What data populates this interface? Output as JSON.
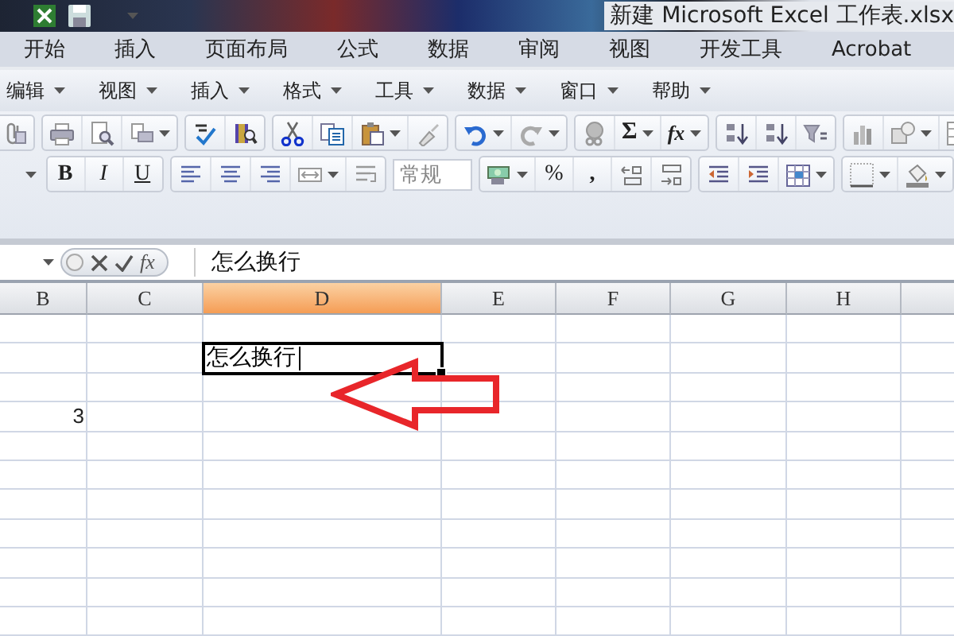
{
  "window": {
    "title": "新建 Microsoft Excel 工作表.xlsx"
  },
  "ribbon_tabs": [
    {
      "label": "开始"
    },
    {
      "label": "插入"
    },
    {
      "label": "页面布局"
    },
    {
      "label": "公式"
    },
    {
      "label": "数据"
    },
    {
      "label": "审阅"
    },
    {
      "label": "视图"
    },
    {
      "label": "开发工具"
    },
    {
      "label": "Acrobat"
    }
  ],
  "menus": [
    {
      "label": "编辑"
    },
    {
      "label": "视图"
    },
    {
      "label": "插入"
    },
    {
      "label": "格式"
    },
    {
      "label": "工具"
    },
    {
      "label": "数据"
    },
    {
      "label": "窗口"
    },
    {
      "label": "帮助"
    }
  ],
  "toolbar": {
    "sum": "Σ",
    "function": "fx",
    "bold": "B",
    "italic": "I",
    "underline": "U",
    "number_format": "常规",
    "percent": "%",
    "comma": ","
  },
  "formula_bar": {
    "function_label": "fx",
    "content": "怎么换行"
  },
  "sheet": {
    "columns": [
      {
        "label": "B",
        "selected": false
      },
      {
        "label": "C",
        "selected": false
      },
      {
        "label": "D",
        "selected": true
      },
      {
        "label": "E",
        "selected": false
      },
      {
        "label": "F",
        "selected": false
      },
      {
        "label": "G",
        "selected": false
      },
      {
        "label": "H",
        "selected": false
      }
    ],
    "rows": [
      {
        "cells": [
          null,
          null,
          null,
          null,
          null,
          null,
          null
        ]
      },
      {
        "cells": [
          null,
          null,
          {
            "text": "怎么换行",
            "active": true
          },
          null,
          null,
          null,
          null
        ]
      },
      {
        "cells": [
          null,
          null,
          null,
          null,
          null,
          null,
          null
        ]
      },
      {
        "cells": [
          {
            "text": "3",
            "active": false
          },
          null,
          null,
          null,
          null,
          null,
          null
        ]
      },
      {
        "cells": [
          null,
          null,
          null,
          null,
          null,
          null,
          null
        ]
      },
      {
        "cells": [
          null,
          null,
          null,
          null,
          null,
          null,
          null
        ]
      },
      {
        "cells": [
          null,
          null,
          null,
          null,
          null,
          null,
          null
        ]
      },
      {
        "cells": [
          null,
          null,
          null,
          null,
          null,
          null,
          null
        ]
      },
      {
        "cells": [
          null,
          null,
          null,
          null,
          null,
          null,
          null
        ]
      },
      {
        "cells": [
          null,
          null,
          null,
          null,
          null,
          null,
          null
        ]
      },
      {
        "cells": [
          null,
          null,
          null,
          null,
          null,
          null,
          null
        ]
      }
    ]
  }
}
